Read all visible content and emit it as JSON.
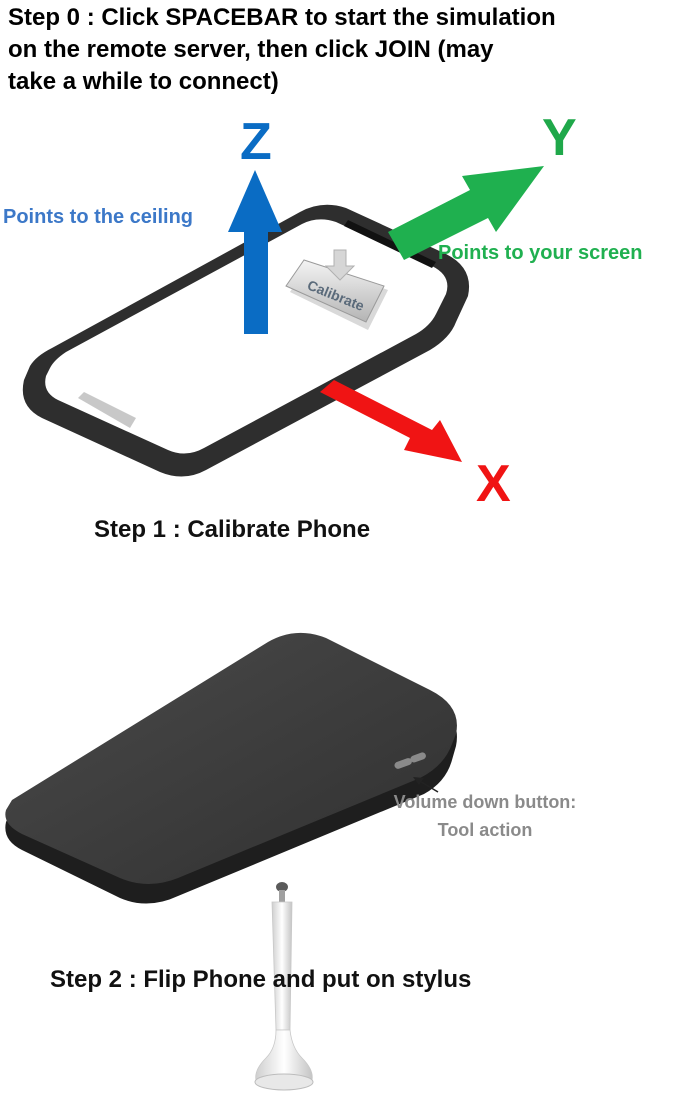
{
  "step0": {
    "text": "Step 0 : Click SPACEBAR to start the simulation\non the remote server, then click JOIN (may\ntake a while to connect)"
  },
  "step1": {
    "title": "Step 1 : Calibrate Phone",
    "axes": {
      "z": {
        "letter": "Z",
        "caption": "Points to the ceiling",
        "color": "#0a6cc4"
      },
      "y": {
        "letter": "Y",
        "caption": "Points to your screen",
        "color": "#1fa84a"
      },
      "x": {
        "letter": "X",
        "color": "#f01414"
      }
    },
    "calibrate_button_label": "Calibrate"
  },
  "step2": {
    "title": "Step 2 : Flip Phone and put on stylus",
    "volume_caption": "Volume down button:\nTool action"
  }
}
